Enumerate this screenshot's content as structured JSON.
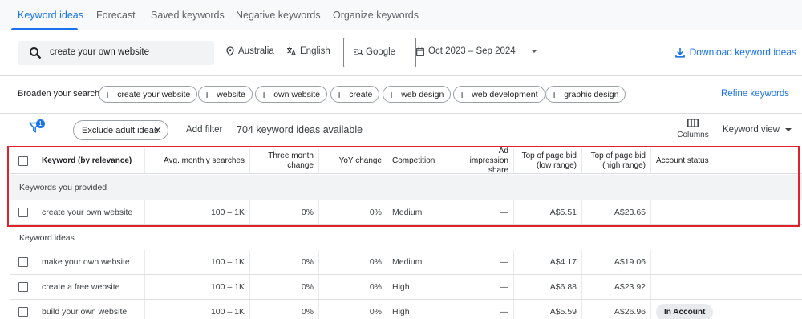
{
  "tabs": [
    {
      "label": "Keyword ideas",
      "active": true
    },
    {
      "label": "Forecast",
      "active": false
    },
    {
      "label": "Saved keywords",
      "active": false
    },
    {
      "label": "Negative keywords",
      "active": false
    },
    {
      "label": "Organize keywords",
      "active": false
    }
  ],
  "search": {
    "value": "create your own website",
    "icon": "search-icon"
  },
  "location": "Australia",
  "language": "English",
  "engine": "Google",
  "date_range": "Oct 2023 – Sep 2024",
  "download_label": "Download keyword ideas",
  "broaden": {
    "label": "Broaden your search:",
    "chips": [
      "create your website",
      "website",
      "own website",
      "create",
      "web design",
      "web development",
      "graphic design"
    ],
    "refine_label": "Refine keywords"
  },
  "filters": {
    "badge_count": "1",
    "adult_chip": "Exclude adult ideas",
    "add_filter": "Add filter",
    "count_text": "704 keyword ideas available",
    "columns_label": "Columns",
    "view_label": "Keyword view"
  },
  "table": {
    "headers": {
      "keyword": "Keyword (by relevance)",
      "avg": "Avg. monthly searches",
      "three_month": "Three month change",
      "yoy": "YoY change",
      "competition": "Competition",
      "ad_share": "Ad impression share",
      "low_bid": "Top of page bid (low range)",
      "high_bid": "Top of page bid (high range)",
      "status": "Account status"
    },
    "group_provided": "Keywords you provided",
    "group_ideas": "Keyword ideas",
    "rows": [
      {
        "keyword": "create your own website",
        "avg": "100 – 1K",
        "three_month": "0%",
        "yoy": "0%",
        "competition": "Medium",
        "ad_share": "—",
        "low_bid": "A$5.51",
        "high_bid": "A$23.65",
        "status": ""
      },
      {
        "keyword": "make your own website",
        "avg": "100 – 1K",
        "three_month": "0%",
        "yoy": "0%",
        "competition": "Medium",
        "ad_share": "—",
        "low_bid": "A$4.17",
        "high_bid": "A$19.06",
        "status": ""
      },
      {
        "keyword": "create a free website",
        "avg": "100 – 1K",
        "three_month": "0%",
        "yoy": "0%",
        "competition": "High",
        "ad_share": "—",
        "low_bid": "A$6.88",
        "high_bid": "A$23.92",
        "status": ""
      },
      {
        "keyword": "build your own website",
        "avg": "100 – 1K",
        "three_month": "0%",
        "yoy": "0%",
        "competition": "High",
        "ad_share": "—",
        "low_bid": "A$5.59",
        "high_bid": "A$26.96",
        "status": "In Account"
      }
    ]
  },
  "colors": {
    "accent": "#1a73e8",
    "highlight": "#e0202a"
  }
}
